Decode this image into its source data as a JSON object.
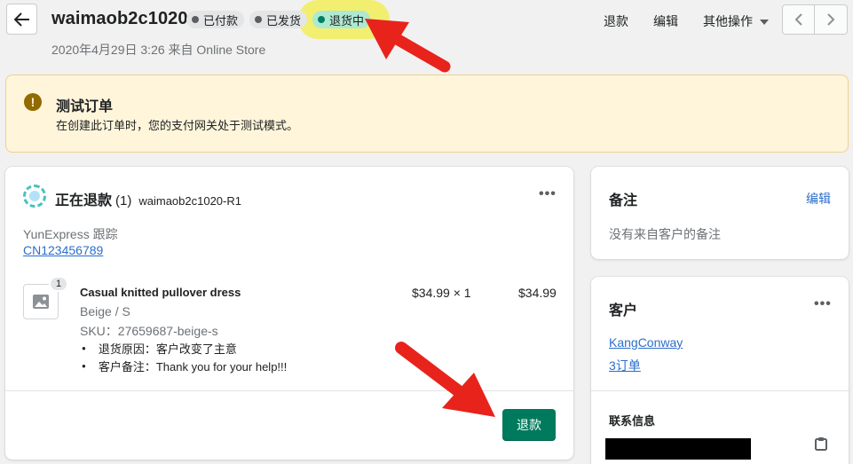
{
  "header": {
    "order_name": "waimaob2c1020",
    "badges": [
      {
        "label": "已付款",
        "status": "paid"
      },
      {
        "label": "已发货",
        "status": "fulfilled"
      },
      {
        "label": "退货中",
        "status": "return-in-progress"
      }
    ],
    "subtitle": "2020年4月29日 3:26 来自 Online Store",
    "actions": {
      "refund": "退款",
      "edit": "编辑",
      "more": "其他操作"
    }
  },
  "banner": {
    "title": "测试订单",
    "text": "在创建此订单时，您的支付网关处于测试模式。",
    "icon": "warning-icon"
  },
  "refund_card": {
    "title": "正在退款",
    "count": "(1)",
    "return_id": "waimaob2c1020-R1",
    "carrier": "YunExpress 跟踪",
    "tracking_number": "CN123456789",
    "item": {
      "quantity": "1",
      "name": "Casual knitted pullover dress",
      "variant": "Beige / S",
      "sku": "SKU：27659687-beige-s",
      "unit_price": "$34.99 × 1",
      "total": "$34.99",
      "reasons": [
        "退货原因：客户改变了主意",
        "客户备注：Thank you for your help!!!"
      ]
    },
    "refund_button": "退款"
  },
  "notes_card": {
    "title": "备注",
    "edit": "编辑",
    "text": "没有来自客户的备注"
  },
  "customer_card": {
    "title": "客户",
    "name": "KangConway",
    "orders": "3订单",
    "contact_title": "联系信息"
  },
  "colors": {
    "primary_button": "#007a5c",
    "link": "#2c6ecb",
    "banner_bg": "#fff5db",
    "annotation_red": "#e8231b",
    "highlight_yellow": "#f2ef59"
  }
}
